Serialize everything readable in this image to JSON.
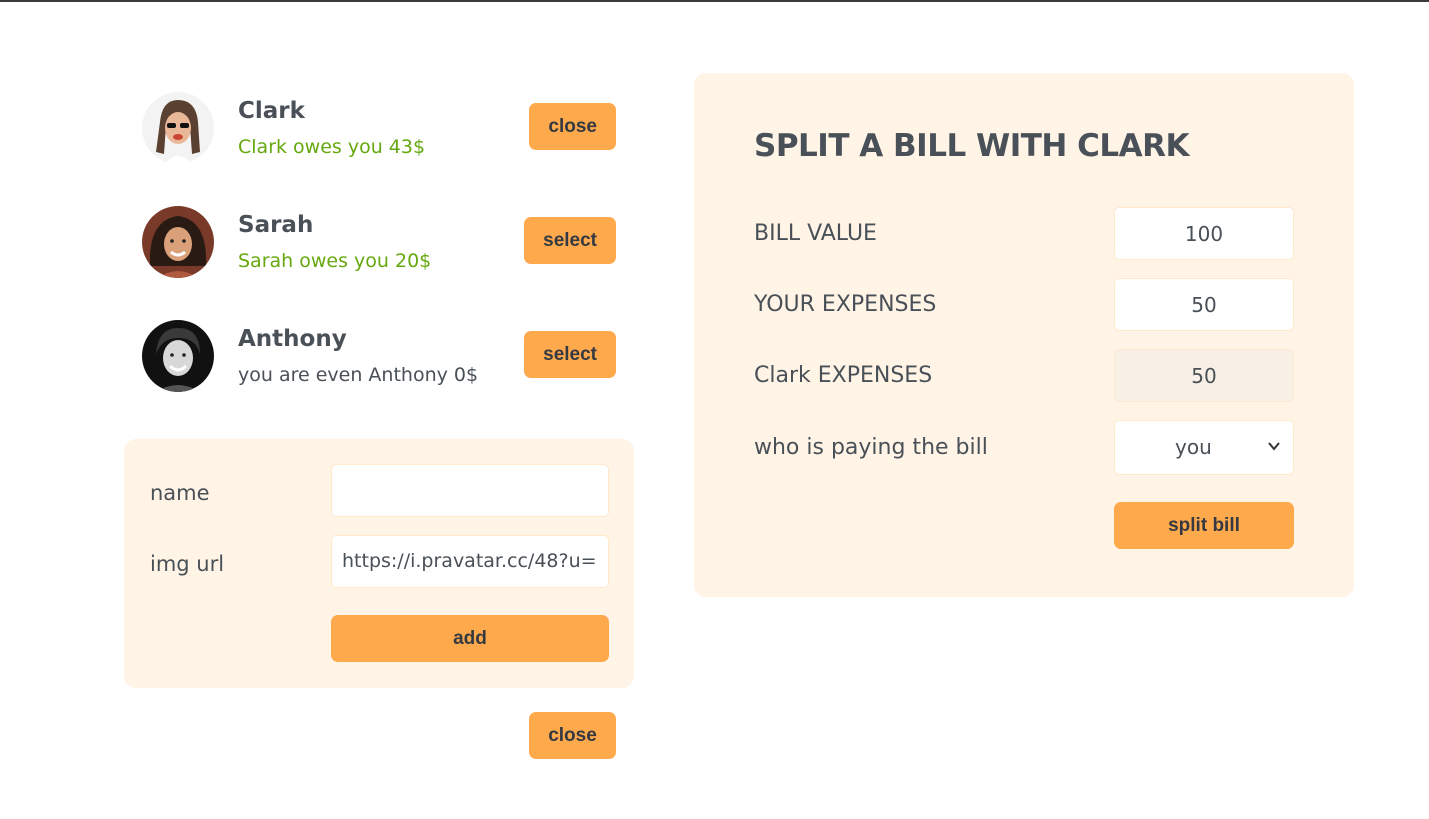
{
  "friends": [
    {
      "name": "Clark",
      "status": "Clark owes you 43$",
      "button": "close",
      "status_color": "#66a80f"
    },
    {
      "name": "Sarah",
      "status": "Sarah owes you 20$",
      "button": "select",
      "status_color": "#66a80f"
    },
    {
      "name": "Anthony",
      "status": "you are even Anthony 0$",
      "button": "select",
      "status_color": "#495057"
    }
  ],
  "add_form": {
    "name_label": "name",
    "name_value": "",
    "img_label": "img url",
    "img_value": "https://i.pravatar.cc/48?u=",
    "add_label": "add"
  },
  "close_form_label": "close",
  "split": {
    "title": "SPLIT A BILL WITH CLARK",
    "bill_label": "BILL VALUE",
    "bill_value": "100",
    "your_label": "YOUR EXPENSES",
    "your_value": "50",
    "friend_label": "Clark EXPENSES",
    "friend_value": "50",
    "payer_label": "who is paying the bill",
    "payer_value": "you",
    "split_label": "split bill"
  },
  "colors": {
    "accent": "#ffa94d",
    "panel": "#fff4e6",
    "owes": "#66a80f",
    "text": "#495057"
  }
}
